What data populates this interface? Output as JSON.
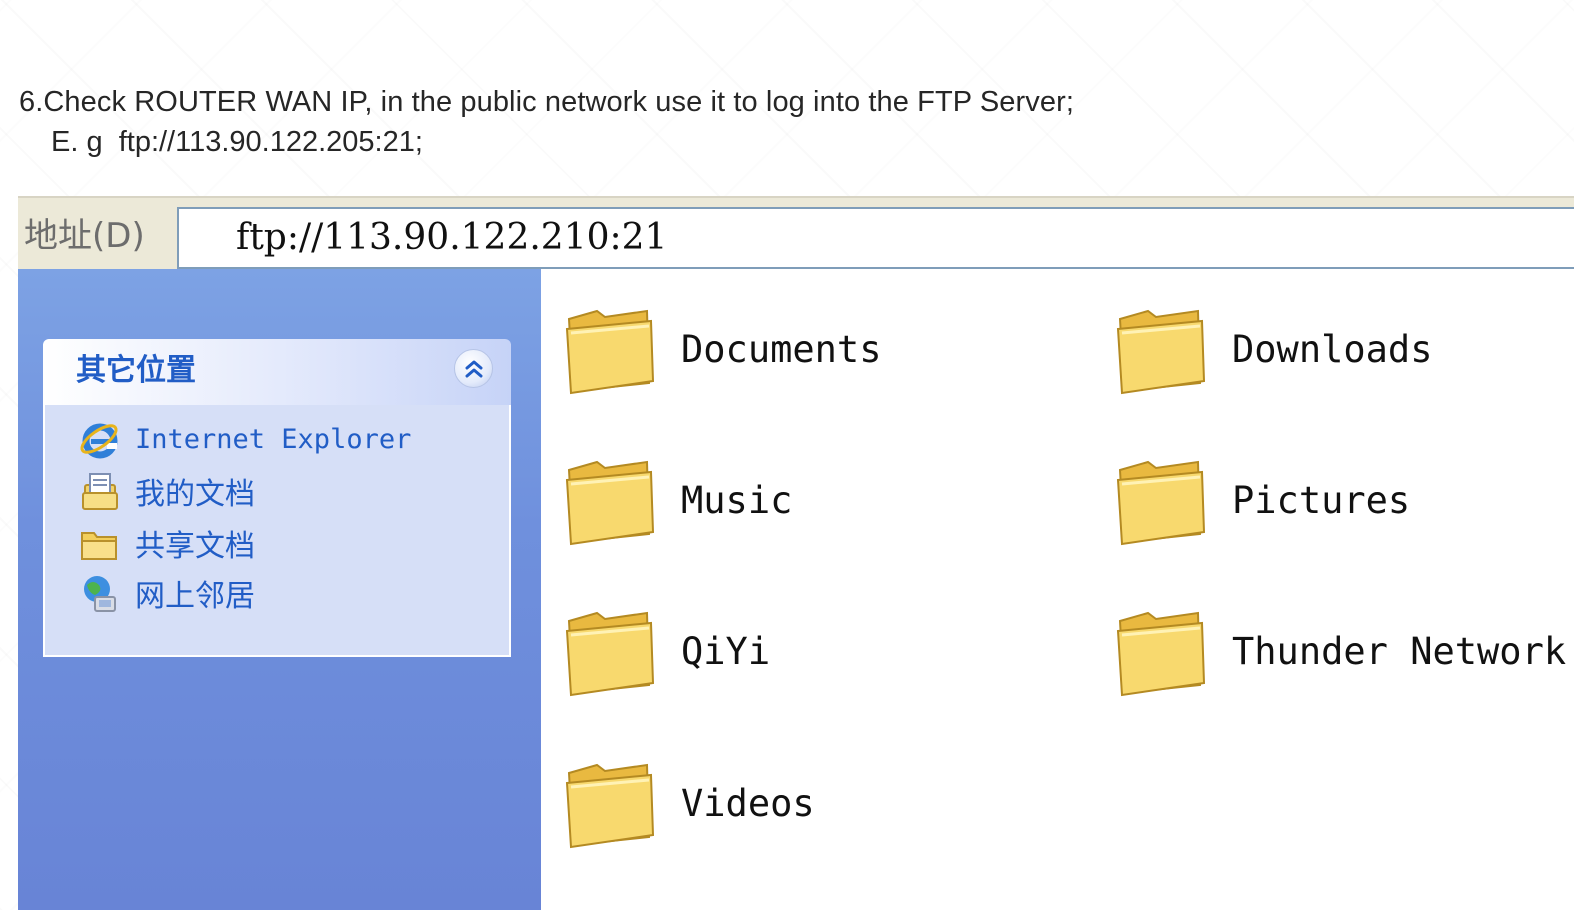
{
  "instructions": {
    "line1": "6.Check ROUTER WAN IP, in the public network use it to log into the FTP Server;",
    "line2": "E. g  ftp://113.90.122.205:21;"
  },
  "address_bar": {
    "label": "地址(D)",
    "value": "ftp://113.90.122.210:21"
  },
  "task_pane": {
    "other_places": {
      "title": "其它位置",
      "items": [
        {
          "label": "Internet Explorer",
          "icon": "internet-explorer-icon"
        },
        {
          "label": "我的文档",
          "icon": "my-documents-icon"
        },
        {
          "label": "共享文档",
          "icon": "shared-documents-icon"
        },
        {
          "label": "网上邻居",
          "icon": "network-places-icon"
        }
      ]
    }
  },
  "files": {
    "folders": [
      {
        "name": "Documents"
      },
      {
        "name": "Downloads"
      },
      {
        "name": "Music"
      },
      {
        "name": "Pictures"
      },
      {
        "name": "QiYi"
      },
      {
        "name": "Thunder Network"
      },
      {
        "name": "Videos"
      }
    ]
  },
  "colors": {
    "pane_blue": "#7da2e4",
    "link_blue": "#215dc6",
    "folder_yellow": "#f7d86a"
  }
}
